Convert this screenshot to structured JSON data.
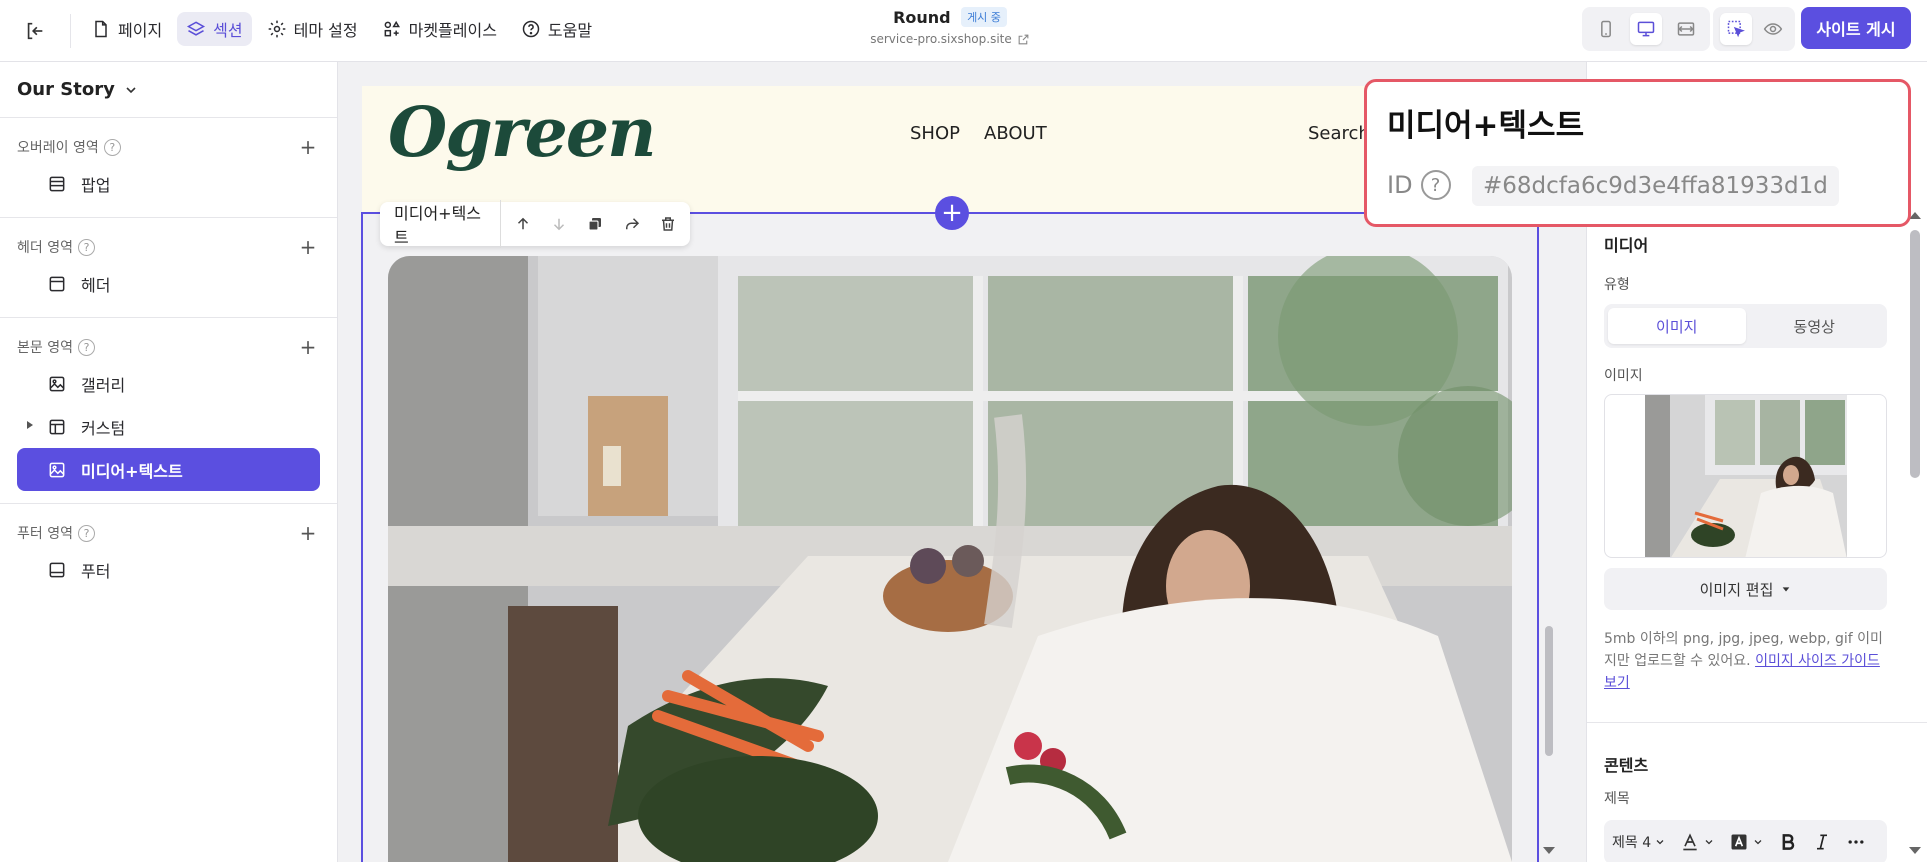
{
  "topbar": {
    "exit_icon": "exit-icon",
    "tabs": [
      {
        "label": "페이지",
        "icon": "page-icon"
      },
      {
        "label": "섹션",
        "icon": "layers-icon",
        "active": true
      },
      {
        "label": "테마 설정",
        "icon": "gear-icon"
      },
      {
        "label": "마켓플레이스",
        "icon": "marketplace-icon"
      },
      {
        "label": "도움말",
        "icon": "help-icon"
      }
    ],
    "site_name": "Round",
    "status_badge": "게시 중",
    "site_url": "service-pro.sixshop.site",
    "devices": [
      "mobile-icon",
      "desktop-icon",
      "fullwidth-icon"
    ],
    "tools": [
      "select-tool-icon",
      "preview-icon"
    ],
    "publish_label": "사이트 게시",
    "accent_color": "#5b4fe0"
  },
  "left_panel": {
    "page_name": "Our Story",
    "groups": [
      {
        "label": "오버레이 영역",
        "items": [
          {
            "label": "팝업",
            "icon": "popup-icon"
          }
        ]
      },
      {
        "label": "헤더 영역",
        "items": [
          {
            "label": "헤더",
            "icon": "header-icon"
          }
        ]
      },
      {
        "label": "본문 영역",
        "items": [
          {
            "label": "갤러리",
            "icon": "image-icon"
          },
          {
            "label": "커스텀",
            "icon": "layout-icon",
            "expandable": true
          },
          {
            "label": "미디어+텍스트",
            "icon": "image-icon",
            "active": true
          }
        ]
      },
      {
        "label": "푸터 영역",
        "items": [
          {
            "label": "푸터",
            "icon": "footer-icon"
          }
        ]
      }
    ]
  },
  "canvas": {
    "logo": "Ogreen",
    "menu": [
      "SHOP",
      "ABOUT"
    ],
    "search": "Search",
    "section_toolbar_label": "미디어+텍스트",
    "section_tools": [
      "move-up-icon",
      "move-down-icon",
      "duplicate-icon",
      "share-icon",
      "delete-icon"
    ]
  },
  "right_panel": {
    "media_title": "미디어",
    "type_label": "유형",
    "type_options": [
      "이미지",
      "동영상"
    ],
    "type_selected": "이미지",
    "image_label": "이미지",
    "edit_image": "이미지 편집",
    "hint": "5mb 이하의 png, jpg, jpeg, webp, gif 이미지만 업로드할 수 있어요.",
    "hint_link": "이미지 사이즈 가이드 보기",
    "content_title": "콘텐츠",
    "heading_label": "제목",
    "heading_style": "제목 4"
  },
  "id_popup": {
    "title": "미디어+텍스트",
    "id_label": "ID",
    "id_value": "#68dcfa6c9d3e4ffa81933d1d",
    "border_color": "#e55866"
  }
}
